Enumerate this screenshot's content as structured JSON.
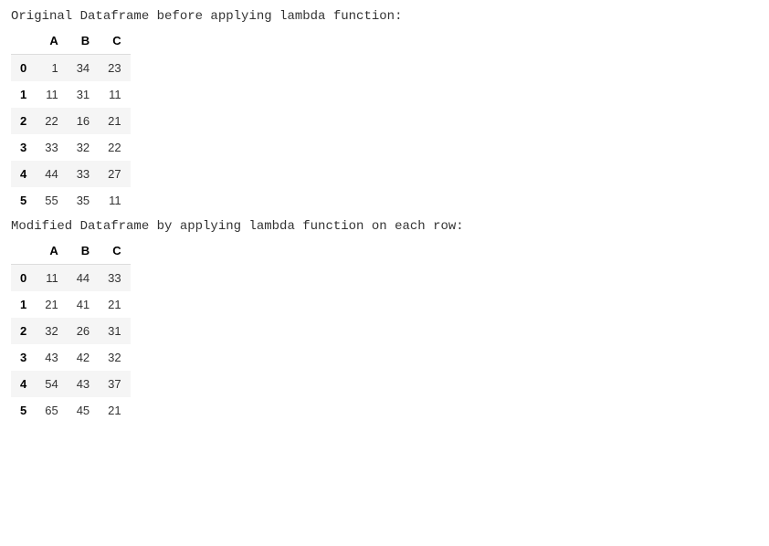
{
  "labels": {
    "before": "Original Dataframe before applying lambda function:",
    "after": "Modified Dataframe by applying lambda function on each row:"
  },
  "table1": {
    "columns": [
      "A",
      "B",
      "C"
    ],
    "index": [
      "0",
      "1",
      "2",
      "3",
      "4",
      "5"
    ],
    "rows": [
      [
        "1",
        "34",
        "23"
      ],
      [
        "11",
        "31",
        "11"
      ],
      [
        "22",
        "16",
        "21"
      ],
      [
        "33",
        "32",
        "22"
      ],
      [
        "44",
        "33",
        "27"
      ],
      [
        "55",
        "35",
        "11"
      ]
    ]
  },
  "table2": {
    "columns": [
      "A",
      "B",
      "C"
    ],
    "index": [
      "0",
      "1",
      "2",
      "3",
      "4",
      "5"
    ],
    "rows": [
      [
        "11",
        "44",
        "33"
      ],
      [
        "21",
        "41",
        "21"
      ],
      [
        "32",
        "26",
        "31"
      ],
      [
        "43",
        "42",
        "32"
      ],
      [
        "54",
        "43",
        "37"
      ],
      [
        "65",
        "45",
        "21"
      ]
    ]
  }
}
